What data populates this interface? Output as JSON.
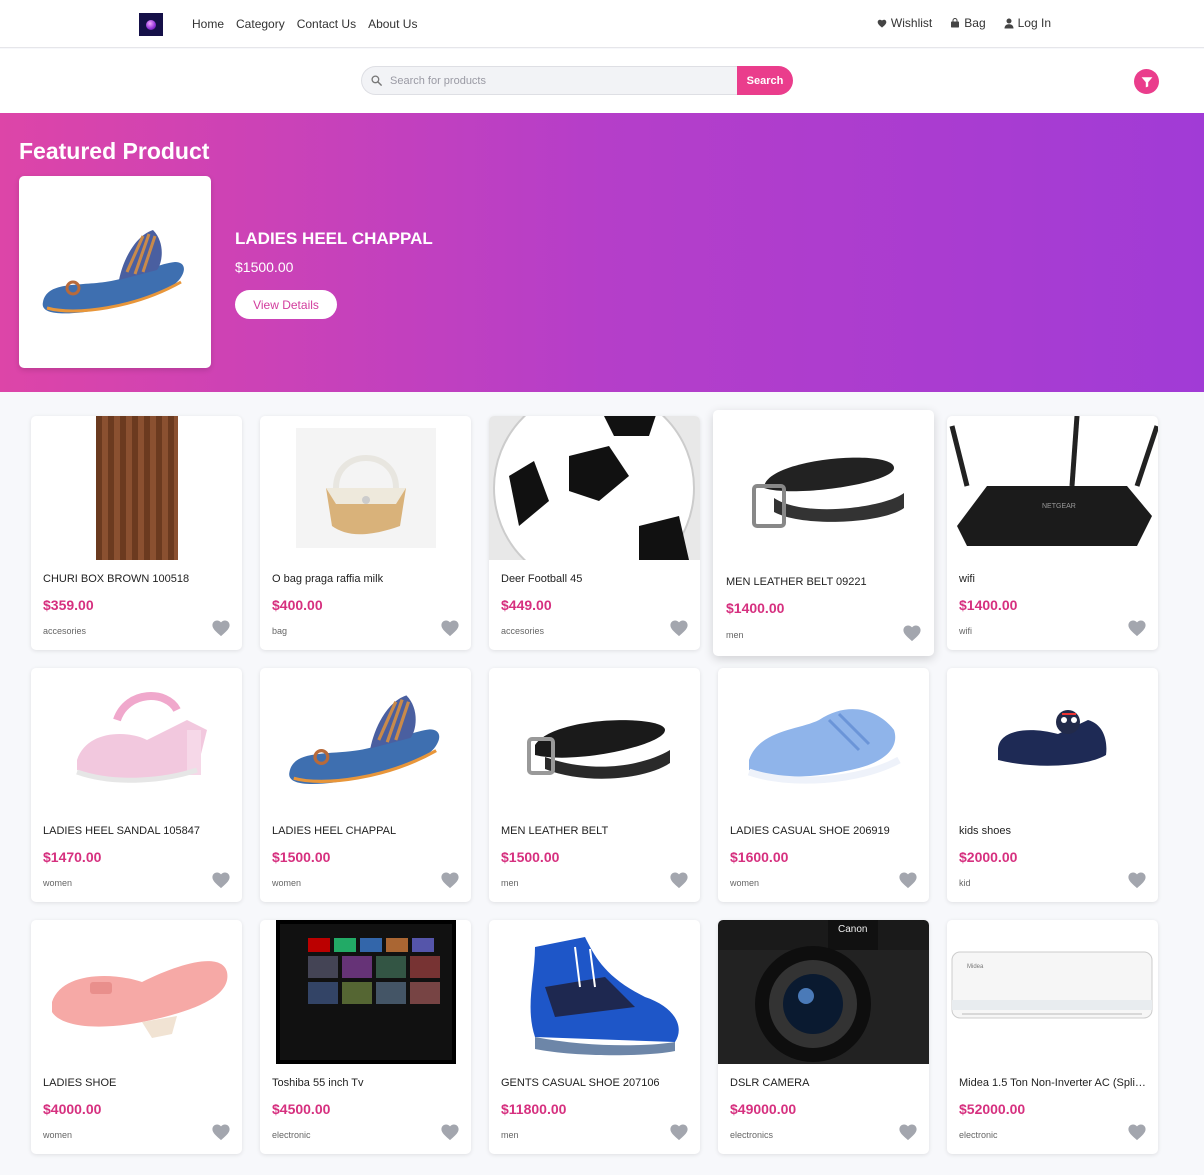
{
  "nav": {
    "links": [
      "Home",
      "Category",
      "Contact Us",
      "About Us"
    ],
    "wishlist": "Wishlist",
    "bag": "Bag",
    "login": "Log In"
  },
  "search": {
    "placeholder": "Search for products",
    "button": "Search"
  },
  "featured": {
    "heading": "Featured Product",
    "name": "LADIES HEEL CHAPPAL",
    "price": "$1500.00",
    "button": "View Details"
  },
  "products": [
    {
      "name": "CHURI BOX BROWN 100518",
      "price": "$359.00",
      "category": "accesories"
    },
    {
      "name": "O bag praga raffia milk",
      "price": "$400.00",
      "category": "bag"
    },
    {
      "name": "Deer Football 45",
      "price": "$449.00",
      "category": "accesories"
    },
    {
      "name": "MEN LEATHER BELT 09221",
      "price": "$1400.00",
      "category": "men"
    },
    {
      "name": "wifi",
      "price": "$1400.00",
      "category": "wifi"
    },
    {
      "name": "LADIES HEEL SANDAL 105847",
      "price": "$1470.00",
      "category": "women"
    },
    {
      "name": "LADIES HEEL CHAPPAL",
      "price": "$1500.00",
      "category": "women"
    },
    {
      "name": "MEN LEATHER BELT",
      "price": "$1500.00",
      "category": "men"
    },
    {
      "name": "LADIES CASUAL SHOE 206919",
      "price": "$1600.00",
      "category": "women"
    },
    {
      "name": "kids shoes",
      "price": "$2000.00",
      "category": "kid"
    },
    {
      "name": "LADIES SHOE",
      "price": "$4000.00",
      "category": "women"
    },
    {
      "name": "Toshiba 55 inch Tv",
      "price": "$4500.00",
      "category": "electronic"
    },
    {
      "name": "GENTS CASUAL SHOE 207106",
      "price": "$11800.00",
      "category": "men"
    },
    {
      "name": "DSLR CAMERA",
      "price": "$49000.00",
      "category": "electronics"
    },
    {
      "name": "Midea 1.5 Ton Non-Inverter AC (Split ...",
      "price": "$52000.00",
      "category": "electronic"
    }
  ],
  "colors": {
    "accent": "#ea3d8c",
    "price": "#d6307f",
    "banner_start": "#dd45a8",
    "banner_end": "#a13bd6"
  }
}
